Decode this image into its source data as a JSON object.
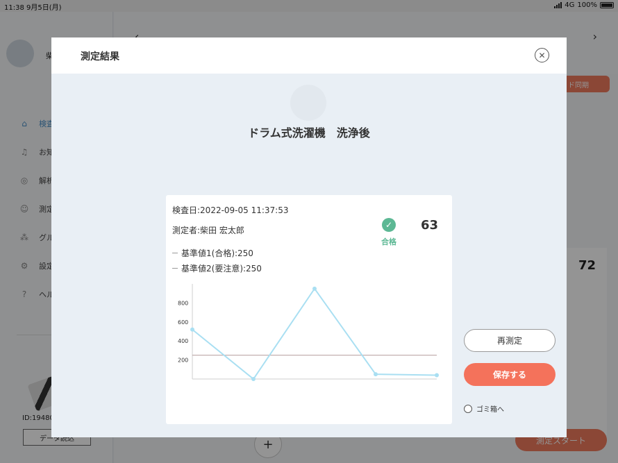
{
  "status_bar": {
    "time": "11:38",
    "date": "9月5日(月)",
    "network": "4G",
    "battery": "100%"
  },
  "background": {
    "user_name_partial": "柴",
    "nav": [
      {
        "label": "検査",
        "icon": "home-icon"
      },
      {
        "label": "お知",
        "icon": "bell-icon"
      },
      {
        "label": "解析",
        "icon": "analysis-icon"
      },
      {
        "label": "測定",
        "icon": "user-icon"
      },
      {
        "label": "グル",
        "icon": "group-icon"
      },
      {
        "label": "設定",
        "icon": "gear-icon"
      },
      {
        "label": "ヘル",
        "icon": "help-icon"
      }
    ],
    "device_id": "ID:19480",
    "data_button": "データ読込",
    "sync_button": "ド同期",
    "score": "72",
    "start_button": "測定スタート",
    "plus": "+"
  },
  "modal": {
    "title": "測定結果",
    "device_name": "ドラム式洗濯機　洗浄後",
    "inspection_date": "検査日:2022-09-05 11:37:53",
    "measurer": "測定者:柴田 宏太郎",
    "result_label": "合格",
    "score": "63",
    "threshold_pass": "基準値1(合格):250",
    "threshold_caution": "基準値2(要注意):250",
    "remeasure_button": "再測定",
    "save_button": "保存する",
    "trash_option": "ゴミ箱へ"
  },
  "chart_data": {
    "type": "line",
    "x": [
      1,
      2,
      3,
      4,
      5
    ],
    "y_ticks": [
      200,
      400,
      600,
      800
    ],
    "ylim": [
      0,
      1000
    ],
    "series": [
      {
        "values": [
          520,
          0,
          950,
          50,
          40
        ],
        "color": "#a9dff2"
      }
    ],
    "thresholds": [
      {
        "value": 250,
        "color": "#b49a9a"
      }
    ]
  }
}
